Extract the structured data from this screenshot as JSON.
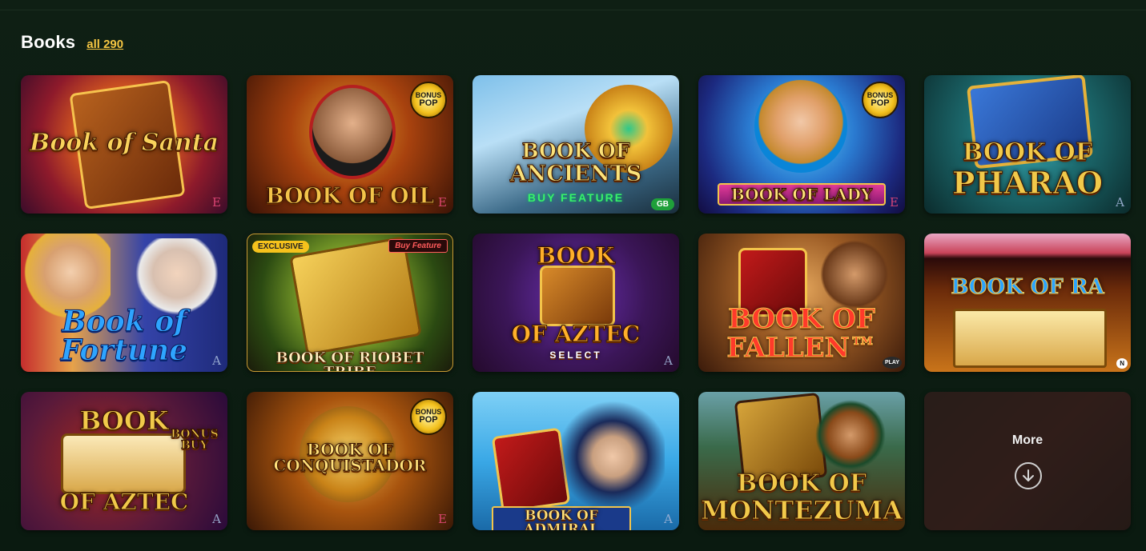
{
  "section": {
    "title": "Books",
    "all_link": "all 290"
  },
  "games": [
    {
      "name": "Book of Santa",
      "title_line1": "Book of Santa",
      "title_line2": "",
      "provider_mark": "E",
      "badge": ""
    },
    {
      "name": "Book of Oil",
      "title_line1": "BOOK OF OIL",
      "title_line2": "",
      "provider_mark": "E",
      "badge": "BONUS POP"
    },
    {
      "name": "Book of Ancients",
      "title_line1": "BOOK OF",
      "title_line2": "ANCIENTS",
      "subtitle": "BUY FEATURE",
      "provider_mark": "GB",
      "badge": ""
    },
    {
      "name": "Book of Lady",
      "title_line1": "BOOK OF LADY",
      "title_line2": "",
      "provider_mark": "E",
      "badge": "BONUS POP"
    },
    {
      "name": "Book of Pharao",
      "title_line1": "BOOK OF",
      "title_line2": "PHARAO",
      "provider_mark": "A",
      "badge": ""
    },
    {
      "name": "Book of Fortune",
      "title_line1": "Book of",
      "title_line2": "Fortune",
      "provider_mark": "A",
      "badge": ""
    },
    {
      "name": "Book of Riobet Tribe",
      "title_line1": "BOOK OF RIOBET TRIBE",
      "title_line2": "",
      "provider_mark": "",
      "badge": "",
      "chip_left": "EXCLUSIVE",
      "chip_right": "Buy Feature"
    },
    {
      "name": "Book of Aztec Select",
      "title_line1": "BOOK",
      "title_line2": "OF AZTEC",
      "subtitle": "SELECT",
      "provider_mark": "A",
      "badge": ""
    },
    {
      "name": "Book of Fallen",
      "title_line1": "BOOK OF",
      "title_line2": "FALLEN™",
      "provider_mark": "PLAY",
      "badge": ""
    },
    {
      "name": "Book of Ra",
      "title_line1": "BOOK OF RA",
      "title_line2": "",
      "provider_mark": "N",
      "badge": ""
    },
    {
      "name": "Book of Aztec Bonus Buy",
      "title_line1": "BOOK",
      "title_line2": "OF AZTEC",
      "subtitle": "BONUS BUY",
      "provider_mark": "A",
      "badge": ""
    },
    {
      "name": "Book of Conquistador",
      "title_line1": "BOOK OF",
      "title_line2": "CONQUISTADOR",
      "provider_mark": "E",
      "badge": "BONUS POP"
    },
    {
      "name": "Book of Admiral",
      "title_line1": "BOOK OF ADMIRAL",
      "title_line2": "",
      "provider_mark": "A",
      "badge": ""
    },
    {
      "name": "Book of Montezuma",
      "title_line1": "BOOK OF",
      "title_line2": "MONTEZUMA",
      "provider_mark": "",
      "badge": ""
    }
  ],
  "more": {
    "label": "More",
    "icon": "arrow-down-circle-icon"
  },
  "colors": {
    "accent_link": "#f4c542",
    "background": "#0f1f14"
  }
}
